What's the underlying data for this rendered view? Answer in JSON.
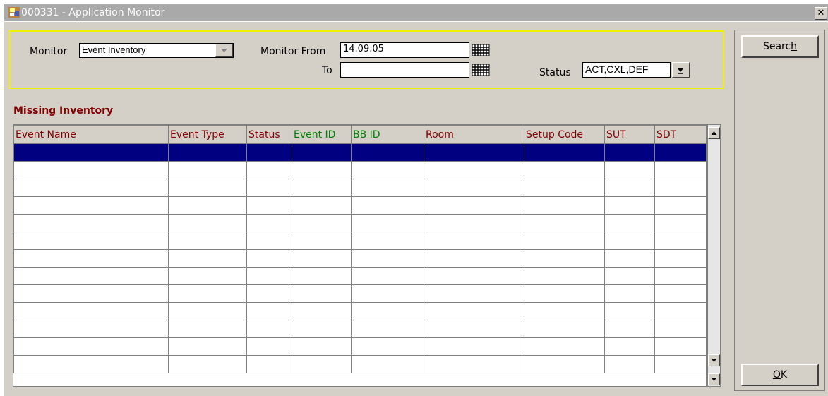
{
  "window": {
    "title": "000331 - Application Monitor",
    "close_glyph": "✕"
  },
  "criteria": {
    "monitor_label": "Monitor",
    "monitor_value": "Event Inventory",
    "monitor_from_label": "Monitor From",
    "monitor_from_value": "14.09.05",
    "to_label": "To",
    "to_value": "",
    "status_label": "Status",
    "status_value": "ACT,CXL,DEF"
  },
  "section_title": "Missing Inventory",
  "grid": {
    "columns": [
      "Event Name",
      "Event Type",
      "Status",
      "Event ID",
      "BB  ID",
      "Room",
      "Setup Code",
      "SUT",
      "SDT"
    ],
    "row_count": 13,
    "selected_row": 0
  },
  "buttons": {
    "search_label_pre": "Searc",
    "search_label_key": "h",
    "ok_label_key": "O",
    "ok_label_post": "K"
  },
  "colors": {
    "title_bar": "#a9a9a9",
    "panel": "#d4d0c8",
    "criteria_border": "#f0f000",
    "header_text": "#800000",
    "header_text_alt": "#008000",
    "selected_row": "#000080"
  },
  "icons": {
    "app": "app-icon",
    "calendar": "calendar-icon",
    "dropdown": "dropdown-arrow-icon",
    "scroll_up": "scroll-up-icon",
    "scroll_down": "scroll-down-icon"
  }
}
